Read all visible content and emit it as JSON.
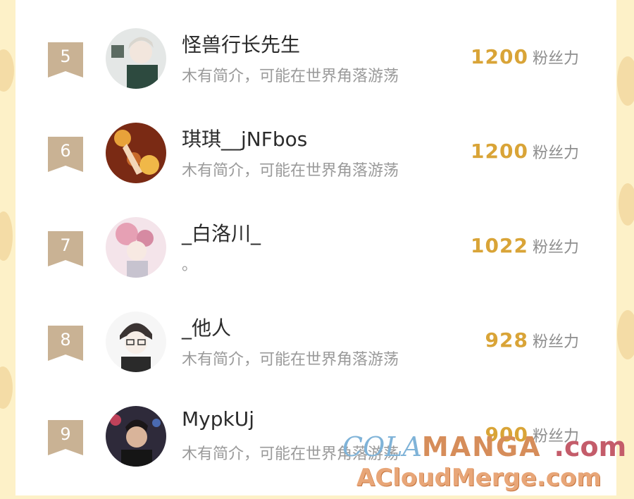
{
  "ranking": [
    {
      "rank": "5",
      "name": "怪兽行长先生",
      "bio": "木有简介，可能在世界角落游荡",
      "fans": "1200",
      "fans_unit": "粉丝力"
    },
    {
      "rank": "6",
      "name": "琪琪__jNFbos",
      "bio": "木有简介，可能在世界角落游荡",
      "fans": "1200",
      "fans_unit": "粉丝力"
    },
    {
      "rank": "7",
      "name": "_白洛川_",
      "bio": "。",
      "fans": "1022",
      "fans_unit": "粉丝力"
    },
    {
      "rank": "8",
      "name": "_他人",
      "bio": "木有简介，可能在世界角落游荡",
      "fans": "928",
      "fans_unit": "粉丝力"
    },
    {
      "rank": "9",
      "name": "MypkUj",
      "bio": "木有简介，可能在世界角落游荡",
      "fans": "900",
      "fans_unit": "粉丝力"
    }
  ],
  "watermark": {
    "cola": "COLA",
    "manga": "MANGA",
    "com": ".com",
    "merge": "ACloudMerge.com"
  },
  "colors": {
    "rank_badge": "#c9b294",
    "fans_number": "#d9a437",
    "background": "#fdf1c8"
  },
  "icons": [
    "rank-ribbon-icon",
    "avatar-image"
  ]
}
